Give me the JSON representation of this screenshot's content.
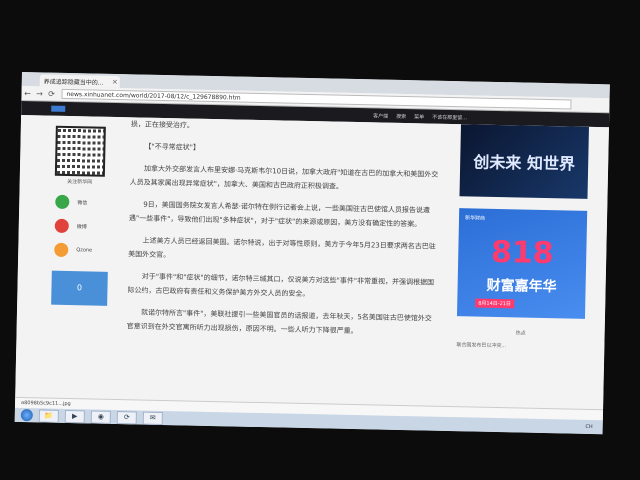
{
  "browser": {
    "tab_title": "养成追踪隐藏当中的...",
    "tab_close": "×",
    "url": "news.xinhuanet.com/world/2017-08/12/c_129678890.htm",
    "nav": {
      "back": "←",
      "forward": "→",
      "reload": "⟳"
    }
  },
  "site_header": {
    "items": [
      "客户端",
      "搜索",
      "菜单"
    ],
    "right_text": "不该在那里留..."
  },
  "left": {
    "qr_label": "关注新华网",
    "share": [
      {
        "label": "微信",
        "color": "#3aa64a"
      },
      {
        "label": "微博",
        "color": "#e0413a"
      },
      {
        "label": "Qzone",
        "color": "#f39b34"
      }
    ],
    "like_count": "0"
  },
  "article": {
    "lead": "损，正在接受治疗。",
    "subhead": "【\"不寻常症状\"】",
    "paragraphs": [
      "加拿大外交部发言人布里安娜·马克斯韦尔10日说，加拿大政府\"知道在古巴的加拿大和美国外交人员及其家属出现异常症状\"，加拿大、美国和古巴政府正积极调查。",
      "9日，美国国务院女发言人希瑟·诺尔特在例行记者会上说，一些美国驻古巴使馆人员报告说遭遇\"一些事件\"，导致他们出现\"多种症状\"，对于\"症状\"的来源或原因，美方没有确定性的答案。",
      "上述美方人员已经返回美国。诺尔特说，出于对等性原则，美方于今年5月23日要求两名古巴驻美国外交官。",
      "对于\"事件\"和\"症状\"的细节，诺尔特三缄其口，仅说美方对这些\"事件\"非常重视，并强调根据国际公约，古巴政府有责任和义务保护美方外交人员的安全。",
      "就诺尔特所言\"事件\"，美联社援引一些美国官员的话报道，去年秋天，5名美国驻古巴使馆外交官意识到在外交官寓所听力出现损伤，原因不明。一些人听力下降很严重。"
    ]
  },
  "right": {
    "ad1_text": "创未来 知世界",
    "ad2_brand": "新华财商",
    "ad2_big": "818",
    "ad2_sub": "财富嘉年华",
    "ad2_date": "8月14日-21日",
    "hot_title": "热点",
    "hot_item": "联合国发布巴以冲突..."
  },
  "download_bar": {
    "file": "a8098b5c9c11...jpg"
  },
  "taskbar": {
    "icons": [
      "📁",
      "▶",
      "◉",
      "⟳",
      "✉"
    ],
    "tray_text": "CH"
  }
}
